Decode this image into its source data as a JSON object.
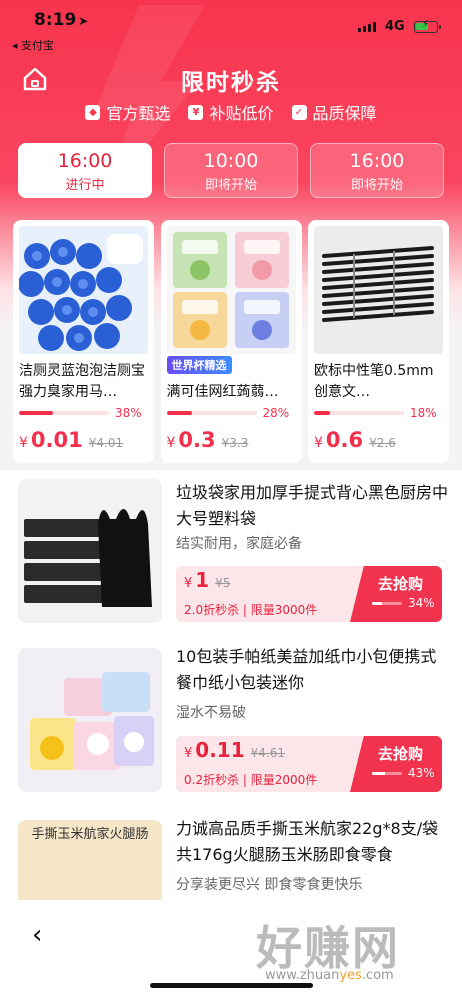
{
  "status": {
    "time": "8:19",
    "back_app": "支付宝",
    "network": "4G"
  },
  "header": {
    "title": "限时秒杀",
    "badges": [
      "官方甄选",
      "补贴低价",
      "品质保障"
    ]
  },
  "tabs": [
    {
      "time": "16:00",
      "status": "进行中",
      "active": true
    },
    {
      "time": "10:00",
      "status": "即将开始",
      "active": false
    },
    {
      "time": "16:00",
      "status": "即将开始",
      "active": false
    }
  ],
  "cards": [
    {
      "name": "洁厕灵蓝泡泡洁厕宝强力臭家用马…",
      "tag": "",
      "progress": 38,
      "progress_text": "38%",
      "currency": "¥",
      "price": "0.01",
      "orig": "¥4.01"
    },
    {
      "name": "满可佳网红蒟蒻…",
      "tag": "世界杯精选",
      "progress": 28,
      "progress_text": "28%",
      "currency": "¥",
      "price": "0.3",
      "orig": "¥3.3"
    },
    {
      "name": "欧标中性笔0.5mm创意文…",
      "tag": "",
      "progress": 18,
      "progress_text": "18%",
      "currency": "¥",
      "price": "0.6",
      "orig": "¥2.6"
    }
  ],
  "list": [
    {
      "title": "垃圾袋家用加厚手提式背心黑色厨房中大号塑料袋",
      "sub": "结实耐用，家庭必备",
      "currency": "¥",
      "price": "1",
      "orig": "¥5",
      "meta": "2.0折秒杀 | 限量3000件",
      "cta": "去抢购",
      "progress": 34,
      "progress_text": "34%"
    },
    {
      "title": "10包装手帕纸美益加纸巾小包便携式餐巾纸小包装迷你",
      "sub": "湿水不易破",
      "currency": "¥",
      "price": "0.11",
      "orig": "¥4.61",
      "meta": "0.2折秒杀 | 限量2000件",
      "cta": "去抢购",
      "progress": 43,
      "progress_text": "43%"
    },
    {
      "title": "力诚高品质手撕玉米航家22g*8支/袋共176g火腿肠玉米肠即食零食",
      "sub": "分享装更尽兴 即食零食更快乐",
      "pic_text": "手撕玉米航家火腿肠"
    }
  ],
  "bottom": {
    "back": "‹",
    "watermark": "好赚网",
    "watermark_url_a": "www.zhuan",
    "watermark_url_b": "yes",
    "watermark_url_c": ".com"
  }
}
